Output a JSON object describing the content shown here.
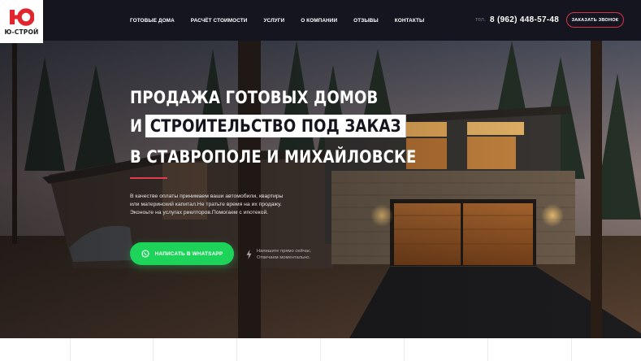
{
  "header": {
    "logo_text": "Ю-СТРОЙ",
    "nav": [
      {
        "label": "ГОТОВЫЕ ДОМА"
      },
      {
        "label": "РАСЧЁТ СТОИМОСТИ"
      },
      {
        "label": "УСЛУГИ"
      },
      {
        "label": "О КОМПАНИИ"
      },
      {
        "label": "ОТЗЫВЫ"
      },
      {
        "label": "КОНТАКТЫ"
      }
    ],
    "phone_label": "тел.",
    "phone": "8 (962) 448-57-48",
    "callback_label": "ЗАКАЗАТЬ ЗВОНОК"
  },
  "hero": {
    "title_line1": "ПРОДАЖА ГОТОВЫХ ДОМОВ",
    "title_line2_prefix": "И",
    "title_line2_highlight": "СТРОИТЕЛЬСТВО ПОД ЗАКАЗ",
    "title_line3": "В СТАВРОПОЛЕ И МИХАЙЛОВСКЕ",
    "description_line1": "В качестве оплаты принимаем ваши автомобили, квартиры",
    "description_line2": "или материнский капитал.Не тратьте время на их продажу.",
    "description_line3": "Эконоьте на услугах риелторов.Помогаем с ипотекой.",
    "whatsapp_button": "НАПИСАТЬ В WHATSAPP",
    "hint_line1": "Напишите прямо сейчас.",
    "hint_line2": "Отвечаем моментально."
  },
  "colors": {
    "header_bg": "#15151f",
    "accent_red": "#d8334a",
    "whatsapp_green": "#1ed35a"
  },
  "icons": {
    "logo": "yu-logo-icon",
    "whatsapp": "whatsapp-icon",
    "hint": "lightning-icon"
  }
}
